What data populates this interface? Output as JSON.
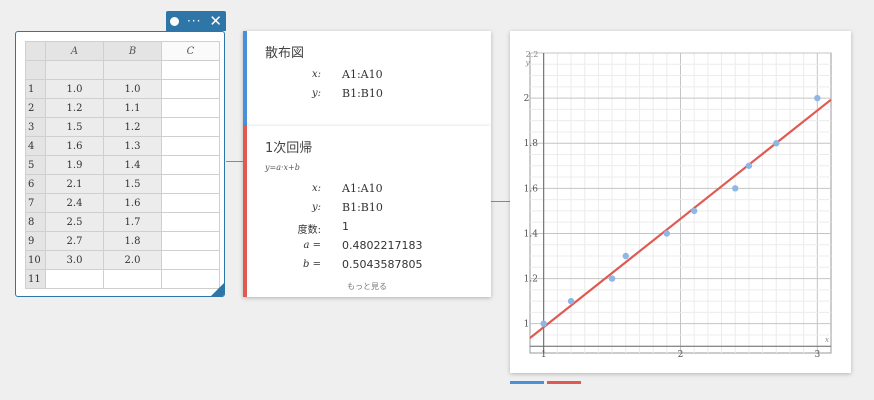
{
  "spreadsheet": {
    "columns": [
      "A",
      "B",
      "C"
    ],
    "rows": [
      {
        "n": "1",
        "a": "1.0",
        "b": "1.0"
      },
      {
        "n": "2",
        "a": "1.2",
        "b": "1.1"
      },
      {
        "n": "3",
        "a": "1.5",
        "b": "1.2"
      },
      {
        "n": "4",
        "a": "1.6",
        "b": "1.3"
      },
      {
        "n": "5",
        "a": "1.9",
        "b": "1.4"
      },
      {
        "n": "6",
        "a": "2.1",
        "b": "1.5"
      },
      {
        "n": "7",
        "a": "2.4",
        "b": "1.6"
      },
      {
        "n": "8",
        "a": "2.5",
        "b": "1.7"
      },
      {
        "n": "9",
        "a": "2.7",
        "b": "1.8"
      },
      {
        "n": "10",
        "a": "3.0",
        "b": "2.0"
      },
      {
        "n": "11",
        "a": "",
        "b": ""
      }
    ],
    "toolbar_icons": [
      "dot-icon",
      "more-icon",
      "close-icon"
    ]
  },
  "scatter_card": {
    "title": "散布図",
    "x_label": "x:",
    "x_value": "A1:A10",
    "y_label": "y:",
    "y_value": "B1:B10",
    "accent": "#4a90d9"
  },
  "regression_card": {
    "title": "1次回帰",
    "formula": "y=a·x+b",
    "x_label": "x:",
    "x_value": "A1:A10",
    "y_label": "y:",
    "y_value": "B1:B10",
    "freq_label": "度数:",
    "freq_value": "1",
    "a_label": "a =",
    "a_value": "0.4802217183",
    "b_label": "b =",
    "b_value": "0.5043587805",
    "more_label": "もっと見る",
    "accent": "#e05a52"
  },
  "chart_data": {
    "type": "scatter",
    "x_ticks": [
      "1",
      "2",
      "3"
    ],
    "y_ticks": [
      "1",
      "1.2",
      "1.4",
      "1.6",
      "1.8",
      "2"
    ],
    "top_tick": "2.2",
    "xlabel": "x",
    "ylabel": "y",
    "xlim": [
      0.9,
      3.1
    ],
    "ylim": [
      0.87,
      2.2
    ],
    "grid": true,
    "series": [
      {
        "x": [
          1.0,
          1.2,
          1.5,
          1.6,
          1.9,
          2.1,
          2.4,
          2.5,
          2.7,
          3.0
        ],
        "y": [
          1.0,
          1.1,
          1.2,
          1.3,
          1.4,
          1.5,
          1.6,
          1.7,
          1.8,
          2.0
        ],
        "color": "#8fb7e6"
      }
    ],
    "regression": {
      "slope": 0.4802217183,
      "intercept": 0.5043587805,
      "color": "#e05a52"
    }
  }
}
